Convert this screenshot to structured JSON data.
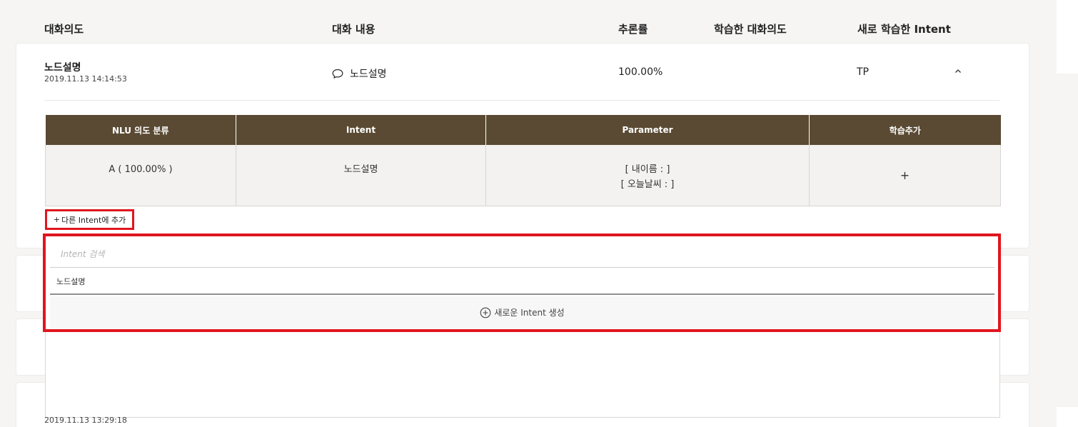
{
  "header": {
    "col_intent": "대화의도",
    "col_content": "대화 내용",
    "col_rate": "추론률",
    "col_learned": "학습한 대화의도",
    "col_new_intent": "새로 학습한 Intent"
  },
  "row1": {
    "title": "노드설명",
    "date": "2019.11.13 14:14:53",
    "message": "노드설명",
    "rate": "100.00%",
    "learned": "",
    "new_intent": "TP"
  },
  "nlu_table": {
    "headers": [
      "NLU 의도 분류",
      "Intent",
      "Parameter",
      "학습추가"
    ],
    "row": {
      "classification": "A ( 100.00% )",
      "intent": "노드설명",
      "param_1": "[ 내이름 : ]",
      "param_2": "[ 오늘날씨 : ]",
      "add": "+"
    }
  },
  "add_other_intent": {
    "plus": "+",
    "label": "다른 Intent에 추가"
  },
  "dropdown": {
    "search_placeholder": "Intent 검색",
    "items": [
      "노드설명"
    ],
    "create_label": "새로운 Intent 생성"
  },
  "row4": {
    "date": "2019.11.13 13:29:18"
  },
  "colors": {
    "table_header": "#5a4a33",
    "highlight": "#e0161e",
    "page_bg": "#f6f5f4"
  }
}
